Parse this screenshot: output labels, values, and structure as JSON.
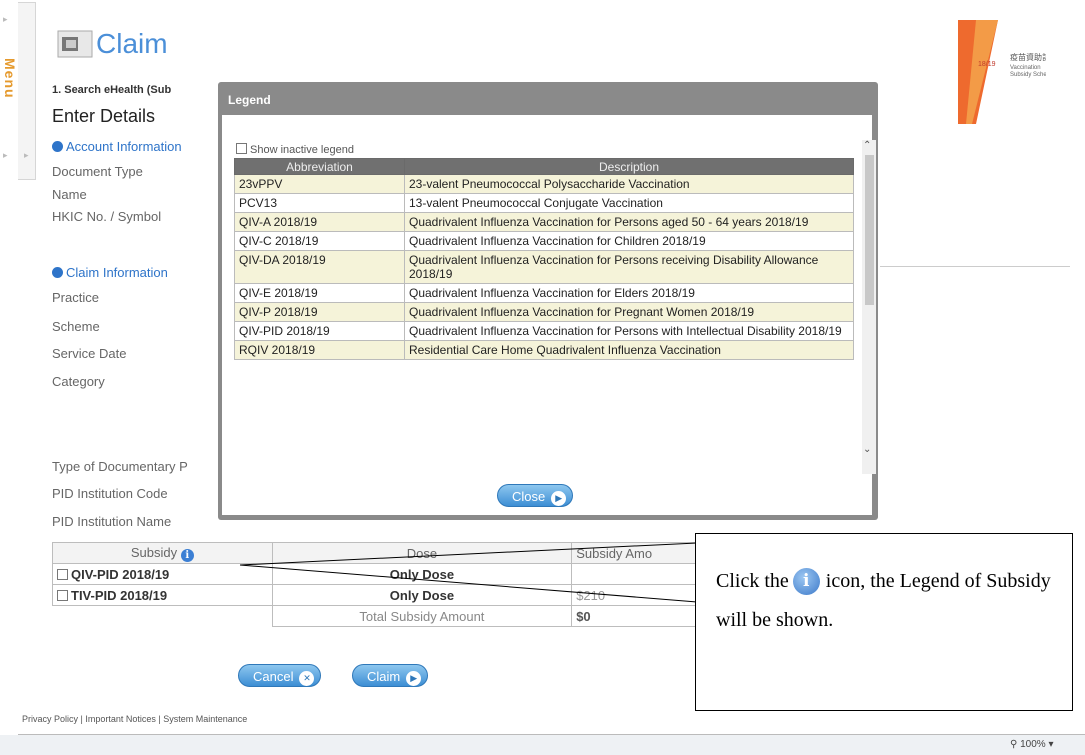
{
  "menu": {
    "label": "Menu"
  },
  "header": {
    "title": "Claim",
    "step": "1. Search eHealth (Sub",
    "section_title": "Enter Details"
  },
  "account_info": {
    "heading": "Account Information",
    "fields": [
      "Document Type",
      "Name",
      "HKIC No. / Symbol"
    ]
  },
  "claim_info": {
    "heading": "Claim Information",
    "fields": [
      "Practice",
      "Scheme",
      "Service Date",
      "Category"
    ]
  },
  "lower_fields": [
    "Type of Documentary P",
    "PID Institution Code",
    "PID Institution Name"
  ],
  "subsidy_table": {
    "headers": [
      "Subsidy",
      "Dose",
      "Subsidy Amo"
    ],
    "rows": [
      {
        "subsidy": "QIV-PID 2018/19",
        "dose": "Only Dose",
        "amount": ""
      },
      {
        "subsidy": "TIV-PID 2018/19",
        "dose": "Only Dose",
        "amount": "$210"
      }
    ],
    "total_label": "Total Subsidy Amount",
    "total_value": "$0"
  },
  "buttons": {
    "cancel": "Cancel",
    "claim": "Claim",
    "close": "Close"
  },
  "footer": {
    "links": "Privacy Policy | Important Notices | System Maintenance"
  },
  "status_bar": {
    "zoom": "100%"
  },
  "logo": {
    "year": "18/19",
    "chinese": "疫苗資助計劃",
    "line1": "Vaccination",
    "line2": "Subsidy Scheme"
  },
  "legend_modal": {
    "title": "Legend",
    "show_inactive": "Show inactive legend",
    "columns": [
      "Abbreviation",
      "Description"
    ],
    "rows": [
      {
        "abbr": "23vPPV",
        "desc": "23-valent Pneumococcal Polysaccharide Vaccination"
      },
      {
        "abbr": "PCV13",
        "desc": "13-valent Pneumococcal Conjugate Vaccination"
      },
      {
        "abbr": "QIV-A 2018/19",
        "desc": "Quadrivalent Influenza Vaccination for Persons aged 50 - 64 years 2018/19"
      },
      {
        "abbr": "QIV-C 2018/19",
        "desc": "Quadrivalent Influenza Vaccination for Children 2018/19"
      },
      {
        "abbr": "QIV-DA 2018/19",
        "desc": "Quadrivalent Influenza Vaccination for Persons receiving Disability Allowance 2018/19"
      },
      {
        "abbr": "QIV-E 2018/19",
        "desc": "Quadrivalent Influenza Vaccination for Elders 2018/19"
      },
      {
        "abbr": "QIV-P 2018/19",
        "desc": "Quadrivalent Influenza Vaccination for Pregnant Women 2018/19"
      },
      {
        "abbr": "QIV-PID 2018/19",
        "desc": "Quadrivalent Influenza Vaccination for Persons with Intellectual Disability 2018/19"
      },
      {
        "abbr": "RQIV 2018/19",
        "desc": "Residential Care Home Quadrivalent Influenza Vaccination"
      }
    ]
  },
  "callout": {
    "before_icon": "Click the",
    "after_icon": "icon, the Legend of Subsidy will be shown."
  },
  "colors": {
    "accent": "#2e74c9",
    "legend_row_alt": "#f5f3d9"
  }
}
